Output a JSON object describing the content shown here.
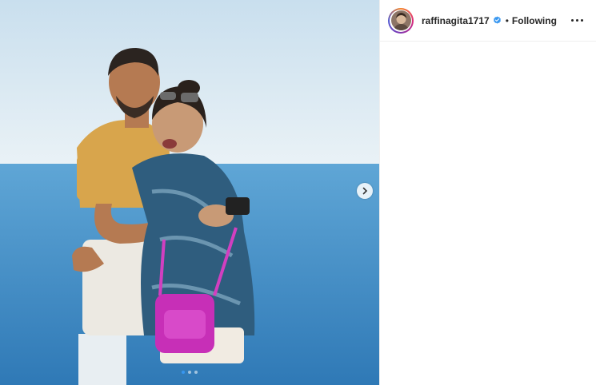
{
  "post": {
    "username": "raffinagita1717",
    "separator": "•",
    "follow_status": "Following",
    "carousel": {
      "total": 3,
      "active_index": 0
    },
    "icons": {
      "verified": "verified-badge-icon",
      "next": "chevron-right-icon",
      "more": "more-options-icon"
    },
    "colors": {
      "verified": "#3897f0",
      "accent": "#3897f0"
    }
  }
}
